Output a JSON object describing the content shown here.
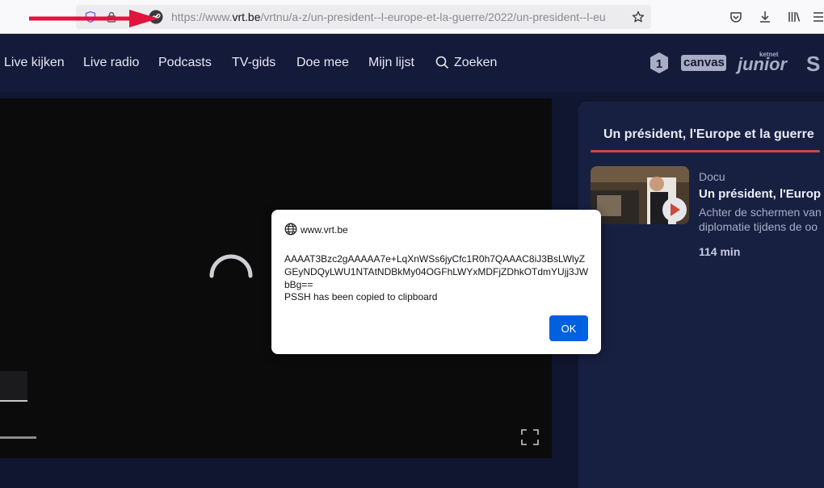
{
  "browser": {
    "url_prefix": "https://www.",
    "url_host": "vrt.be",
    "url_path": "/vrtnu/a-z/un-president--l-europe-et-la-guerre/2022/un-president--l-eu"
  },
  "nav": {
    "items": [
      "Live kijken",
      "Live radio",
      "Podcasts",
      "TV-gids",
      "Doe mee",
      "Mijn lijst",
      "Zoeken"
    ],
    "brands": [
      "1",
      "canvas",
      "ketnet",
      "junior",
      "S"
    ]
  },
  "panel": {
    "tab": "Un président, l'Europe et la guerre",
    "episode": {
      "category": "Docu",
      "title": "Un président, l'Europ",
      "description_line1": "Achter de schermen van",
      "description_line2": "diplomatie tijdens de oo",
      "duration": "114 min"
    }
  },
  "dialog": {
    "host": "www.vrt.be",
    "pssh": "AAAAT3Bzc2gAAAAA7e+LqXnWSs6jyCfc1R0h7QAAAC8iJ3BsLWlyZGEyNDQyLWU1NTAtNDBkMy04OGFhLWYxMDFjZDhkOTdmYUjj3JWbBg==",
    "message": "PSSH has been copied to clipboard",
    "ok_label": "OK"
  },
  "colors": {
    "accent_red": "#c74b3f",
    "ok_blue": "#0061e0",
    "arrow_red": "#e0143c"
  }
}
